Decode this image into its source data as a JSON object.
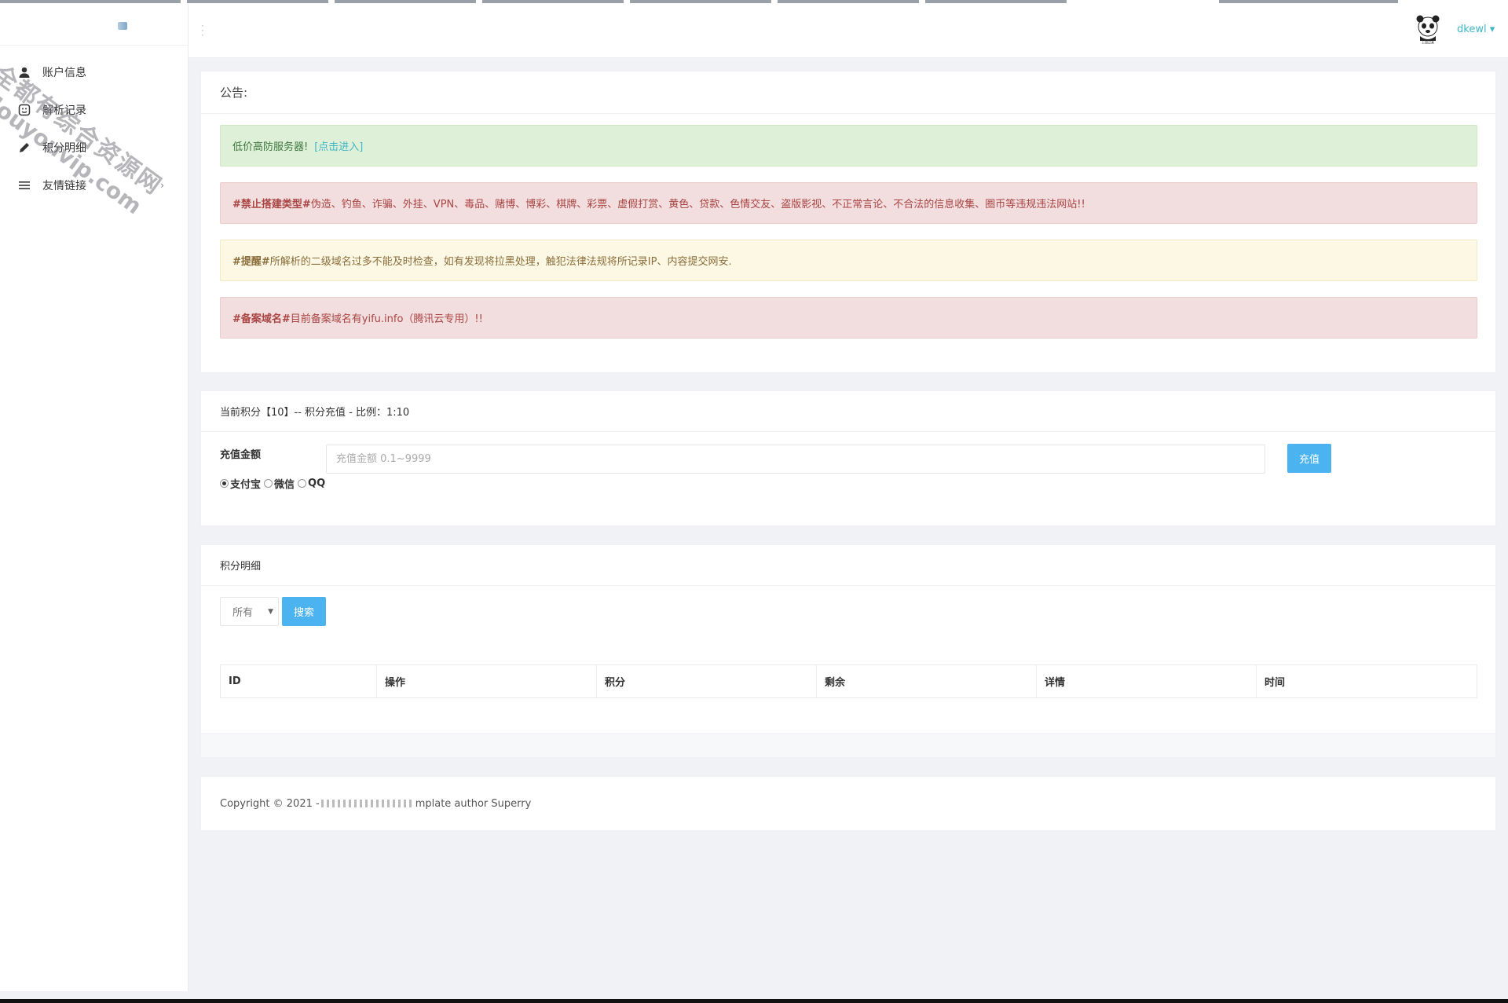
{
  "header": {
    "username": "dkewl",
    "caret": "▾",
    "avatar_icon": "panda-meme-avatar"
  },
  "sidebar": {
    "items": [
      {
        "label": "账户信息",
        "icon": "user-icon"
      },
      {
        "label": "解析记录",
        "icon": "record-icon"
      },
      {
        "label": "积分明细",
        "icon": "pencil-icon"
      },
      {
        "label": "友情链接",
        "icon": "menu-icon",
        "chevron": "›"
      }
    ]
  },
  "watermark": {
    "line1": "全都有综合资源网",
    "line2": "douyouvip.com"
  },
  "notice": {
    "title": "公告:",
    "alerts": [
      {
        "text": "低价高防服务器!",
        "link": "[点击进入]"
      },
      {
        "tag": "#禁止搭建类型#",
        "text": " 伪造、钓鱼、诈骗、外挂、VPN、毒品、赌博、博彩、棋牌、彩票、虚假打赏、黄色、贷款、色情交友、盗版影视、不正常言论、不合法的信息收集、圈币等违规违法网站!!"
      },
      {
        "tag": "#提醒#",
        "text": " 所解析的二级域名过多不能及时检查，如有发现将拉黑处理，触犯法律法规将所记录IP、内容提交网安."
      },
      {
        "tag": "#备案域名#",
        "text": " 目前备案域名有yifu.info（腾讯云专用）!!"
      }
    ]
  },
  "recharge": {
    "title": "当前积分【10】-- 积分充值 - 比例：1:10",
    "amount_label": "充值金额",
    "amount_placeholder": "充值金额 0.1~9999",
    "amount_value": "",
    "button": "充值",
    "methods": [
      "支付宝",
      "微信",
      "QQ"
    ],
    "selected_method": "支付宝"
  },
  "points": {
    "title": "积分明细",
    "filter_value": "所有",
    "search_button": "搜索",
    "columns": [
      "ID",
      "操作",
      "积分",
      "剩余",
      "详情",
      "时间"
    ],
    "rows": []
  },
  "footer": {
    "text_before": "Copyright © 2021 - ",
    "text_after": "mplate author Superry"
  },
  "colors": {
    "accent": "#4bb3f0",
    "link": "#3fb6c6",
    "success_bg": "#dff0d8",
    "danger_bg": "#f2dede",
    "warning_bg": "#fcf8e3"
  }
}
